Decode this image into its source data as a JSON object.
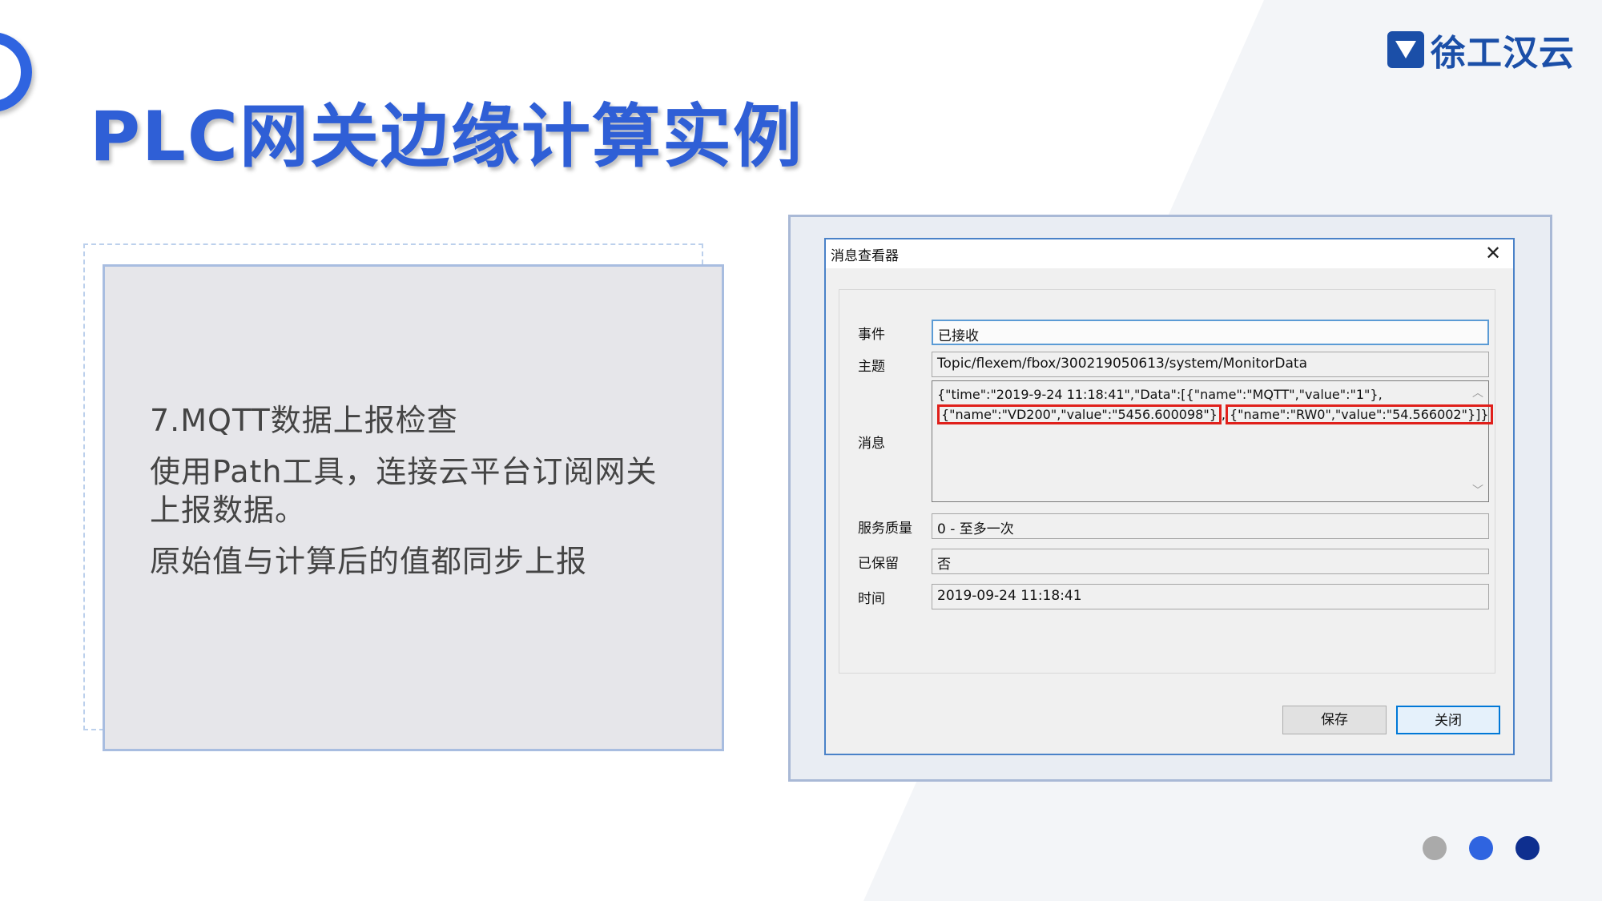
{
  "slide": {
    "title": "PLC网关边缘计算实例",
    "brand": "徐工汉云",
    "body": [
      "7.MQTT数据上报检查",
      "使用Path工具，连接云平台订阅网关上报数据。",
      "原始值与计算后的值都同步上报"
    ],
    "colors": {
      "accent": "#2f5fd6",
      "brand": "#1b4fa8",
      "highlight": "#e0201b"
    },
    "pager": {
      "count": 3,
      "active": 3,
      "colors": [
        "#aaaaaa",
        "#2f64e0",
        "#0e2f8f"
      ]
    }
  },
  "dialog": {
    "title": "消息查看器",
    "close_icon": "close-icon",
    "fields": {
      "event": {
        "label": "事件",
        "value": "已接收"
      },
      "topic": {
        "label": "主题",
        "value": "Topic/flexem/fbox/300219050613/system/MonitorData"
      },
      "message": {
        "label": "消息",
        "line1": "{\"time\":\"2019-9-24 11:18:41\",\"Data\":[{\"name\":\"MQTT\",\"value\":\"1\"},",
        "seg1": "{\"name\":\"VD200\",\"value\":\"5456.600098\"}",
        "sep": ",",
        "seg2": "{\"name\":\"RW0\",\"value\":\"54.566002\"}]}"
      },
      "qos": {
        "label": "服务质量",
        "value": "0 - 至多一次"
      },
      "retained": {
        "label": "已保留",
        "value": "否"
      },
      "time": {
        "label": "时间",
        "value": "2019-09-24 11:18:41"
      }
    },
    "buttons": {
      "save": "保存",
      "close": "关闭"
    }
  }
}
